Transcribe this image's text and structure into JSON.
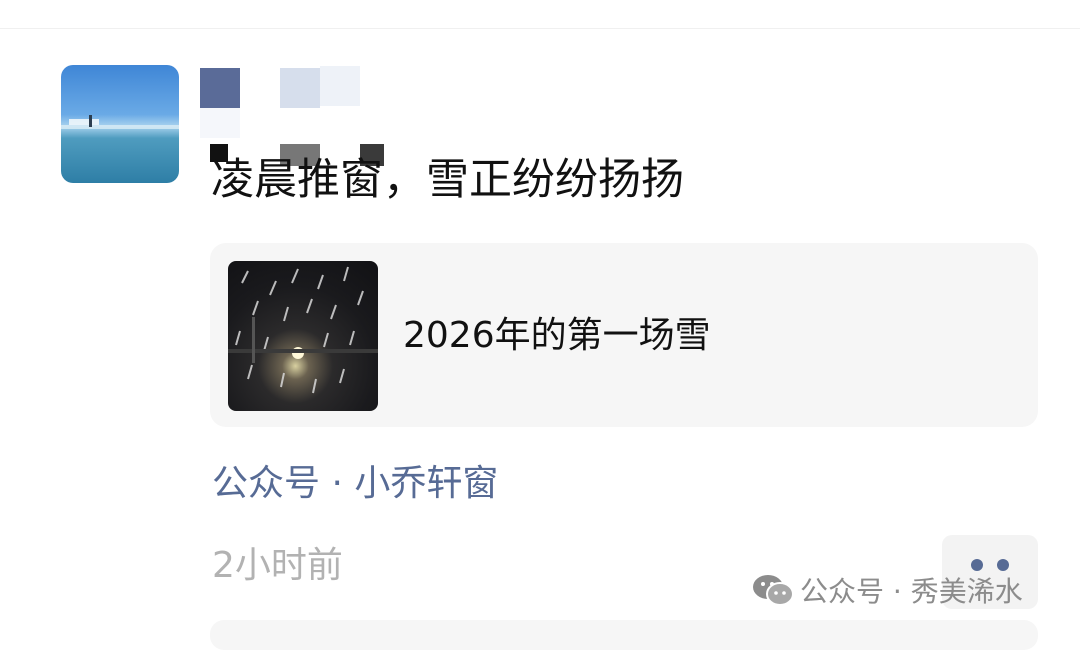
{
  "post": {
    "text": "凌晨推窗，雪正纷纷扬扬",
    "link_card": {
      "title": "2026年的第一场雪"
    },
    "source": "公众号 · 小乔轩窗",
    "time": "2小时前"
  },
  "watermark": {
    "icon": "wechat-icon",
    "text": "公众号 · 秀美浠水"
  },
  "colors": {
    "link_blue": "#576b95",
    "timestamp_gray": "#b2b2b2",
    "card_bg": "#f6f6f6"
  }
}
